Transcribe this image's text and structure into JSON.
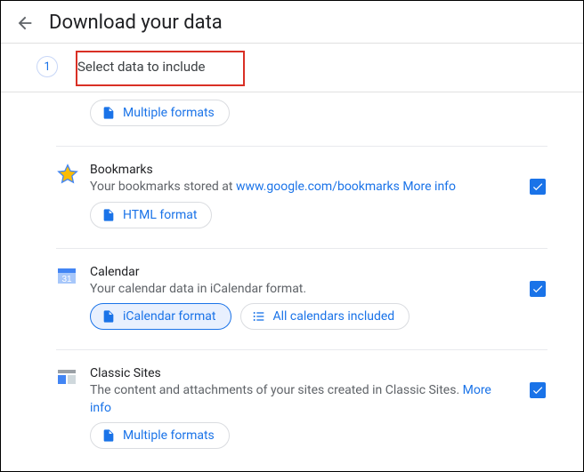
{
  "header": {
    "title": "Download your data"
  },
  "step": {
    "num": "1",
    "label": "Select data to include"
  },
  "top_pill": {
    "label": "Multiple formats"
  },
  "sections": [
    {
      "title": "Bookmarks",
      "desc_pre": "Your bookmarks stored at ",
      "link1": "www.google.com/bookmarks",
      "more": "More info",
      "pill1": "HTML format"
    },
    {
      "title": "Calendar",
      "desc": "Your calendar data in iCalendar format.",
      "pill1": "iCalendar format",
      "pill2": "All calendars included"
    },
    {
      "title": "Classic Sites",
      "desc_pre": "The content and attachments of your sites created in Classic Sites. ",
      "more": "More info",
      "pill1": "Multiple formats"
    }
  ]
}
